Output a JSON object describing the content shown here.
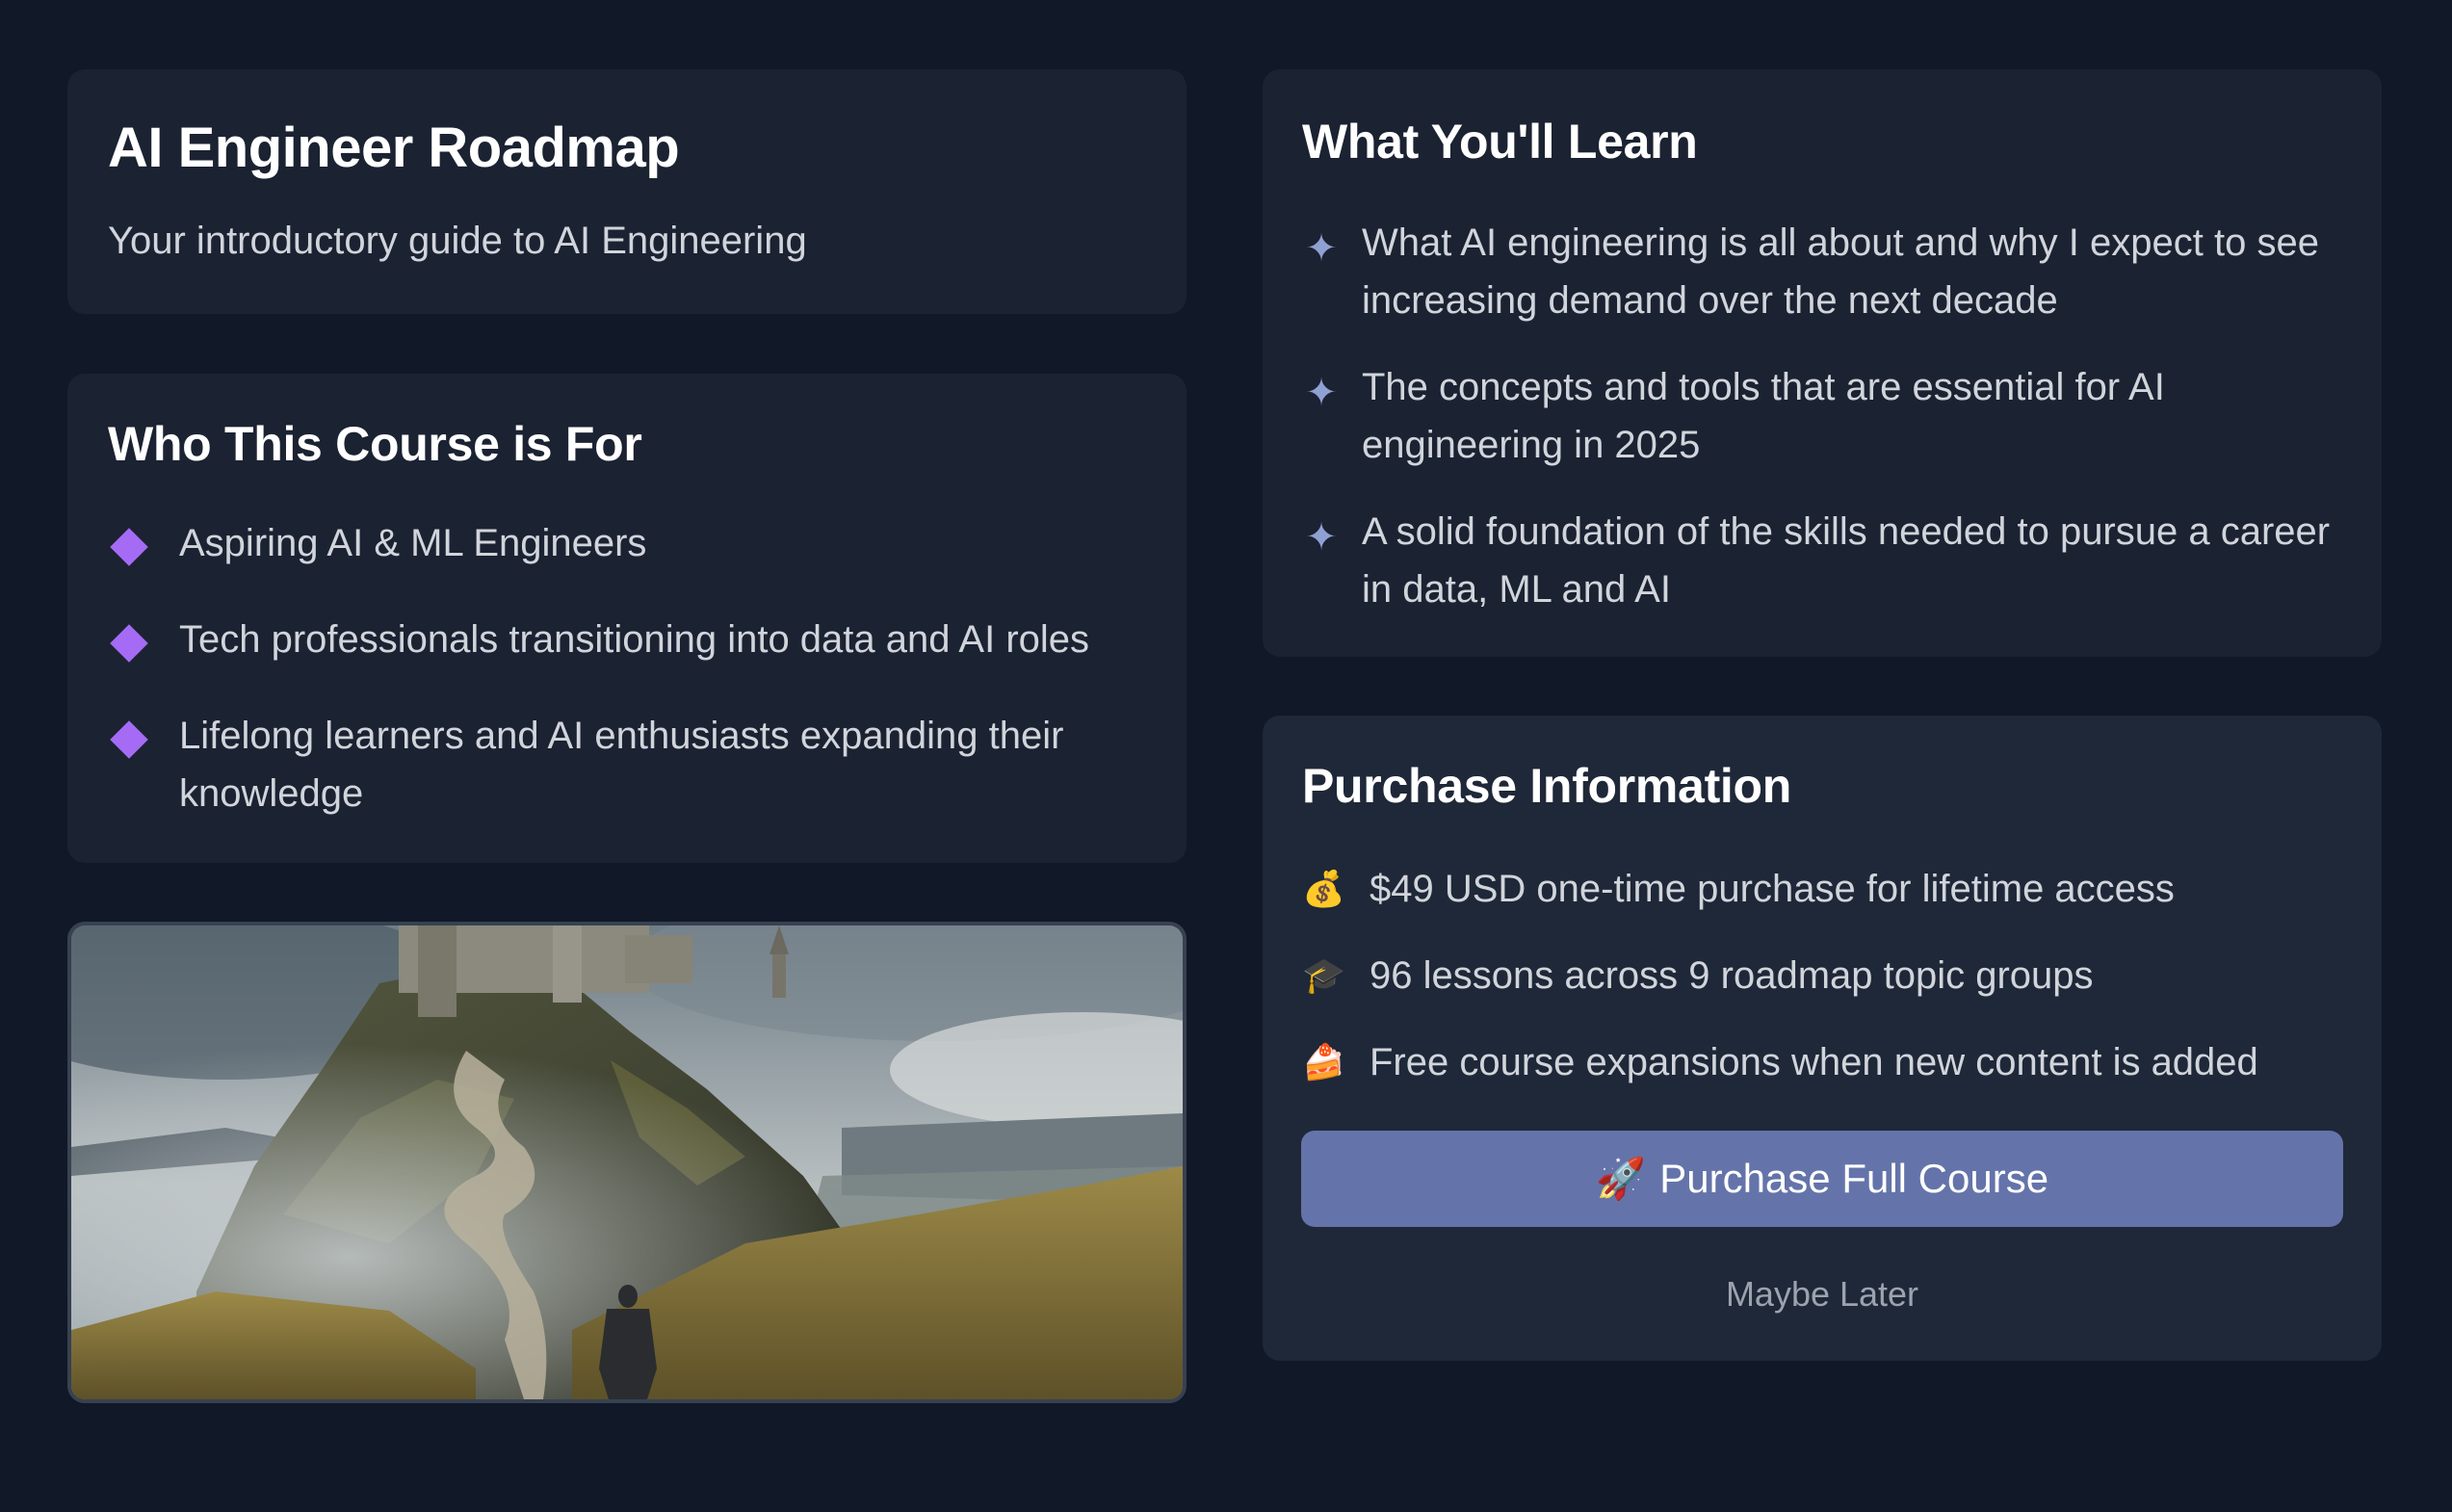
{
  "header": {
    "title": "AI Engineer Roadmap",
    "subtitle": "Your introductory guide to AI Engineering"
  },
  "audience": {
    "title": "Who This Course is For",
    "icon": "diamond-icon",
    "accent": "#a56bf4",
    "items": [
      "Aspiring AI & ML Engineers",
      "Tech professionals transitioning into data and AI roles",
      "Lifelong learners and AI enthusiasts expanding their knowledge"
    ]
  },
  "learn": {
    "title": "What You'll Learn",
    "icon": "sparkle-icon",
    "items": [
      "What AI engineering is all about and why I expect to see increasing demand over the next decade",
      "The concepts and tools that are essential for AI engineering in 2025",
      "A solid foundation of the skills needed to pursue a career in data, ML and AI"
    ]
  },
  "purchase": {
    "title": "Purchase Information",
    "items": [
      {
        "icon": "money-bag-icon",
        "glyph": "💰",
        "text": "$49 USD one-time purchase for lifetime access"
      },
      {
        "icon": "graduation-cap-icon",
        "glyph": "🎓",
        "text": "96 lessons across 9 roadmap topic groups"
      },
      {
        "icon": "cake-icon",
        "glyph": "🍰",
        "text": "Free course expansions when new content is added"
      }
    ],
    "button_icon": "🚀",
    "button_label": "Purchase Full Course",
    "button_color": "#6474aa",
    "secondary_label": "Maybe Later"
  },
  "colors": {
    "background": "#111827",
    "card": "#1b2232",
    "card_alt": "#1f2838"
  }
}
